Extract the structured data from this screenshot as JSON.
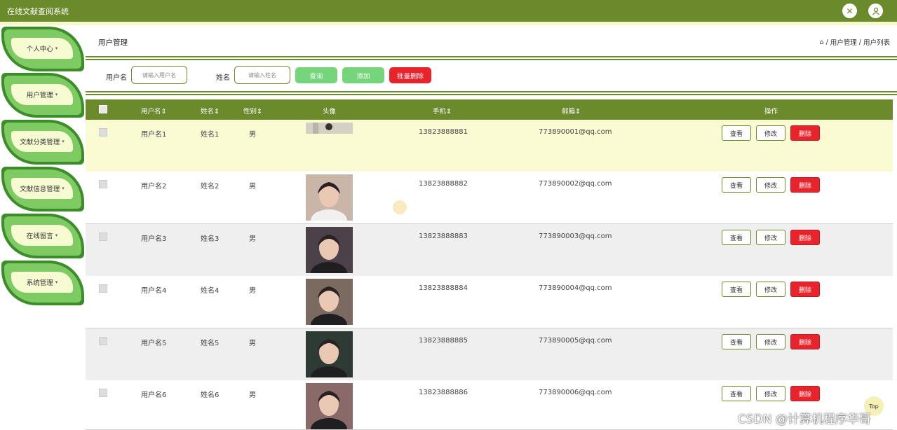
{
  "app": {
    "title": "在线文献查阅系统"
  },
  "sidebar": {
    "items": [
      {
        "label": "个人中心"
      },
      {
        "label": "用户管理"
      },
      {
        "label": "文献分类管理"
      },
      {
        "label": "文献信息管理"
      },
      {
        "label": "在线留言"
      },
      {
        "label": "系统管理"
      }
    ]
  },
  "page": {
    "title": "用户管理"
  },
  "breadcrumb": {
    "home_icon": "home-icon",
    "sep": "/",
    "level1": "用户管理",
    "level2": "用户列表"
  },
  "search": {
    "username_label": "用户名",
    "username_placeholder": "请输入用户名",
    "name_label": "姓名",
    "name_placeholder": "请输入姓名",
    "query_label": "查询",
    "add_label": "添加",
    "batch_delete_label": "批量删除"
  },
  "table": {
    "headers": {
      "username": "用户名",
      "name": "姓名",
      "gender": "性别",
      "avatar": "头像",
      "phone": "手机",
      "email": "邮箱",
      "ops": "操作"
    },
    "rows": [
      {
        "username": "用户名1",
        "name": "姓名1",
        "gender": "男",
        "phone": "13823888881",
        "email": "773890001@qq.com",
        "avatar": "#d4d0c4"
      },
      {
        "username": "用户名2",
        "name": "姓名2",
        "gender": "男",
        "phone": "13823888882",
        "email": "773890002@qq.com",
        "avatar": "#c9b6a8"
      },
      {
        "username": "用户名3",
        "name": "姓名3",
        "gender": "男",
        "phone": "13823888883",
        "email": "773890003@qq.com",
        "avatar": "#4a4248"
      },
      {
        "username": "用户名4",
        "name": "姓名4",
        "gender": "男",
        "phone": "13823888884",
        "email": "773890004@qq.com",
        "avatar": "#7a6a60"
      },
      {
        "username": "用户名5",
        "name": "姓名5",
        "gender": "男",
        "phone": "13823888885",
        "email": "773890005@qq.com",
        "avatar": "#2e3a34"
      },
      {
        "username": "用户名6",
        "name": "姓名6",
        "gender": "男",
        "phone": "13823888886",
        "email": "773890006@qq.com",
        "avatar": "#8a6a68"
      }
    ],
    "actions": {
      "view": "查看",
      "edit": "修改",
      "delete": "删除"
    }
  },
  "colors": {
    "brand": "#6b8a2c",
    "highlight_row": "#fafbd2",
    "alt_row": "#efefef",
    "danger": "#e8232b",
    "green_btn": "#74d57a"
  },
  "top_button": "Top",
  "watermark": "CSDN @计算机程序华哥"
}
